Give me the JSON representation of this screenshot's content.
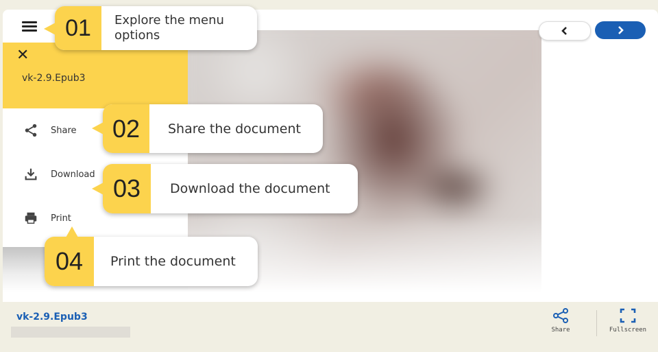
{
  "document": {
    "title": "vk-2.9.Epub3"
  },
  "side_menu": {
    "title": "vk-2.9.Epub3",
    "items": [
      {
        "label": "Share",
        "icon": "share-icon"
      },
      {
        "label": "Download",
        "icon": "download-icon"
      },
      {
        "label": "Print",
        "icon": "print-icon"
      }
    ]
  },
  "navigation": {
    "prev_icon": "chevron-left-icon",
    "next_icon": "chevron-right-icon"
  },
  "callouts": [
    {
      "number": "01",
      "text": "Explore the menu options"
    },
    {
      "number": "02",
      "text": "Share the document"
    },
    {
      "number": "03",
      "text": "Download the document"
    },
    {
      "number": "04",
      "text": "Print the document"
    }
  ],
  "footer": {
    "title": "vk-2.9.Epub3",
    "share_label": "Share",
    "fullscreen_label": "Fullscreen"
  },
  "colors": {
    "accent_yellow": "#fcd34d",
    "brand_blue": "#1a5fb4",
    "footer_bg": "#f1efe3"
  }
}
